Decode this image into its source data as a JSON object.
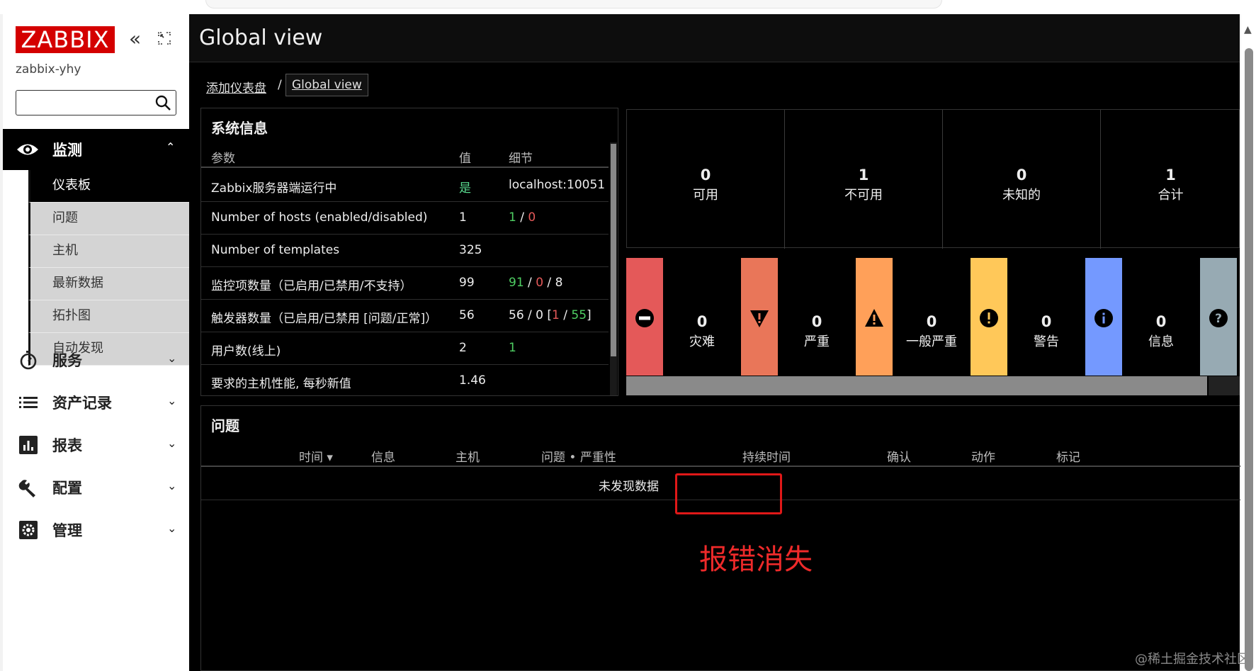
{
  "sidebar": {
    "logo": "ZABBIX",
    "server_name": "zabbix-yhy",
    "search": {
      "value": "",
      "placeholder": ""
    },
    "monitoring": {
      "label": "监测",
      "items": [
        "仪表板",
        "问题",
        "主机",
        "最新数据",
        "拓扑图",
        "自动发现"
      ]
    },
    "menu": [
      {
        "label": "服务",
        "icon": "stopwatch-icon"
      },
      {
        "label": "资产记录",
        "icon": "list-icon"
      },
      {
        "label": "报表",
        "icon": "bar-chart-icon"
      },
      {
        "label": "配置",
        "icon": "wrench-icon"
      },
      {
        "label": "管理",
        "icon": "gear-icon"
      }
    ]
  },
  "header": {
    "title": "Global view"
  },
  "breadcrumb": {
    "parent": "添加仪表盘",
    "separator": "/",
    "current": "Global view"
  },
  "system_info": {
    "title": "系统信息",
    "columns": [
      "参数",
      "值",
      "细节"
    ],
    "rows": [
      {
        "param": "Zabbix服务器端运行中",
        "value": "是",
        "detail": "localhost:10051"
      },
      {
        "param": "Number of hosts (enabled/disabled)",
        "value": "1",
        "detail_a": "1",
        "detail_sep": "/",
        "detail_b": "0"
      },
      {
        "param": "Number of templates",
        "value": "325"
      },
      {
        "param": "监控项数量（已启用/已禁用/不支持）",
        "value": "99",
        "detail_a": "91",
        "detail_b": "0",
        "detail_c": "8"
      },
      {
        "param": "触发器数量（已启用/已禁用 [问题/正常]）",
        "value": "56",
        "detail_prefix": "56 / 0 [",
        "detail_a": "1",
        "detail_b": "55",
        "detail_suffix": "]"
      },
      {
        "param": "用户数(线上)",
        "value": "2",
        "detail": "1"
      },
      {
        "param": "要求的主机性能, 每秒新值",
        "value": "1.46"
      }
    ]
  },
  "host_availability": [
    {
      "count": "0",
      "label": "可用"
    },
    {
      "count": "1",
      "label": "不可用"
    },
    {
      "count": "0",
      "label": "未知的"
    },
    {
      "count": "1",
      "label": "合计"
    }
  ],
  "severity": {
    "colors": {
      "disaster": "#e45959",
      "high": "#e97659",
      "average": "#ffa059",
      "warning": "#ffc859",
      "information": "#7499ff",
      "not_classified": "#97aab3"
    },
    "items": [
      {
        "count": "0",
        "label": "灾难",
        "icon": "no-entry-icon"
      },
      {
        "count": "0",
        "label": "严重",
        "icon": "exclamation-triangle-down-icon"
      },
      {
        "count": "0",
        "label": "一般严重",
        "icon": "warning-triangle-icon"
      },
      {
        "count": "0",
        "label": "警告",
        "icon": "exclamation-circle-icon"
      },
      {
        "count": "0",
        "label": "信息",
        "icon": "info-circle-icon"
      }
    ],
    "last_icon": "question-circle-icon"
  },
  "problems": {
    "title": "问题",
    "columns": [
      "时间 ▾",
      "信息",
      "主机",
      "问题 • 严重性",
      "持续时间",
      "确认",
      "动作",
      "标记"
    ],
    "empty_text": "未发现数据"
  },
  "annotation": {
    "text": "报错消失",
    "color": "#ee2a2a"
  },
  "watermark": "@稀土掘金技术社区"
}
